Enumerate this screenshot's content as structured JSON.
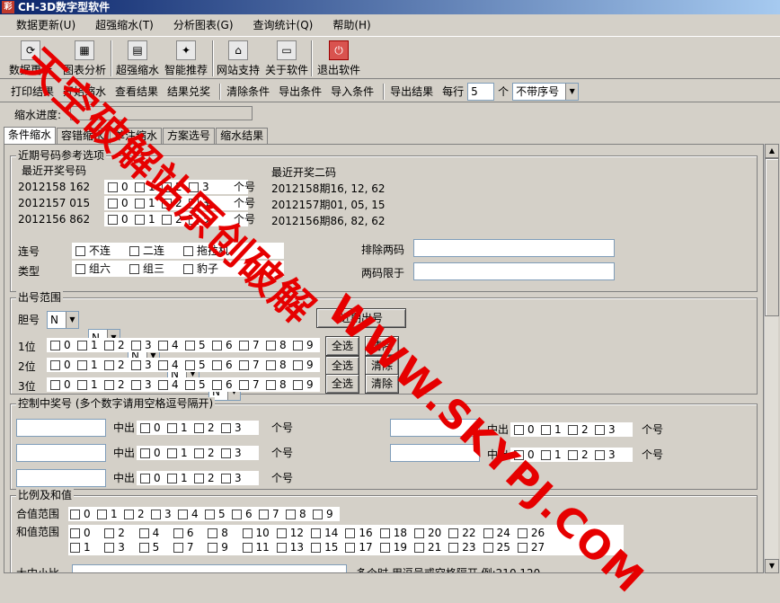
{
  "window": {
    "title": "CH-3D数字型软件"
  },
  "menu": [
    "数据更新(U)",
    "超强缩水(T)",
    "分析图表(G)",
    "查询统计(Q)",
    "帮助(H)"
  ],
  "toolbar": {
    "items": [
      "数据更新",
      "图表分析",
      "超强缩水",
      "智能推荐",
      "网站支持",
      "关于软件",
      "退出软件"
    ]
  },
  "cmdbar": {
    "items": [
      "打印结果",
      "开始缩水",
      "查看结果",
      "结果兑奖",
      "清除条件",
      "导出条件",
      "导入条件",
      "导出结果"
    ],
    "per_line_label": "每行",
    "per_line_value": "5",
    "unit": "个",
    "mode_value": "不带序号"
  },
  "progress_label": "缩水进度:",
  "tabs": [
    "条件缩水",
    "容错缩水",
    "单注缩水",
    "方案选号",
    "缩水结果"
  ],
  "recent": {
    "group_title": "近期号码参考选项",
    "left_title": "最近开奖号码",
    "right_title": "最近开奖二码",
    "rows": [
      {
        "period": "2012158",
        "num": "162",
        "two": "2012158期16, 12, 62"
      },
      {
        "period": "2012157",
        "num": "015",
        "two": "2012157期01, 05, 15"
      },
      {
        "period": "2012156",
        "num": "862",
        "two": "2012156期86, 82, 62"
      }
    ],
    "digits": [
      "0",
      "1",
      "2",
      "3"
    ],
    "unit_label": "个号",
    "lianhao_label": "连号",
    "lianhao_opts": [
      "不连",
      "二连",
      "拖拉机"
    ],
    "type_label": "类型",
    "type_opts": [
      "组六",
      "组三",
      "豹子"
    ],
    "exclude_label": "排除两码",
    "limit_label": "两码限于"
  },
  "range": {
    "group_title": "出号范围",
    "dan_label": "胆号",
    "combo_value": "N",
    "recent_btn": "近期出号",
    "rows": [
      "1位",
      "2位",
      "3位"
    ],
    "digits": [
      "0",
      "1",
      "2",
      "3",
      "4",
      "5",
      "6",
      "7",
      "8",
      "9"
    ],
    "select_all": "全选",
    "clear": "清除"
  },
  "control": {
    "group_title": "控制中奖号 (多个数字请用空格逗号隔开)",
    "hit_label": "中出",
    "digits": [
      "0",
      "1",
      "2",
      "3"
    ],
    "unit": "个号"
  },
  "ratio": {
    "group_title": "比例及和值",
    "hezhi_label": "合值范围",
    "hezhi_digits": [
      "0",
      "1",
      "2",
      "3",
      "4",
      "5",
      "6",
      "7",
      "8",
      "9"
    ],
    "sum_label": "和值范围",
    "sum_row1": [
      "0",
      "2",
      "4",
      "6",
      "8",
      "10",
      "12",
      "14",
      "16",
      "18",
      "20",
      "22",
      "24",
      "26"
    ],
    "sum_row2": [
      "1",
      "3",
      "5",
      "7",
      "9",
      "11",
      "13",
      "15",
      "17",
      "19",
      "21",
      "23",
      "25",
      "27"
    ],
    "size_label": "大中小比",
    "hint": "多个时,用逗号或空格隔开 例:210,120"
  },
  "watermark": {
    "line1": "天空破解站原创破解",
    "line2": "WWW.SKYPJ.COM"
  }
}
